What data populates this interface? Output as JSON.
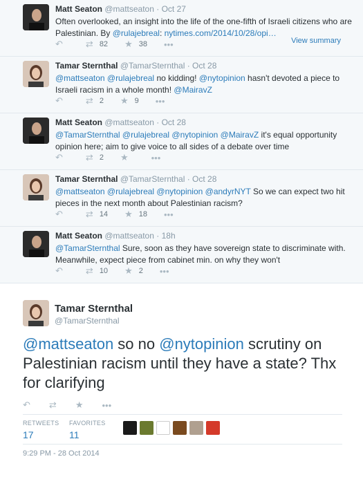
{
  "thread": [
    {
      "author": "Matt Seaton",
      "handle": "@mattseaton",
      "time": "Oct 27",
      "avatar": "m",
      "text_parts": [
        {
          "t": "Often overlooked, an insight into the life of the one-fifth of Israeli citizens who are Palestinian. By ",
          "link": false
        },
        {
          "t": "@rulajebreal",
          "link": true
        },
        {
          "t": ": ",
          "link": false
        },
        {
          "t": "nytimes.com/2014/10/28/opi…",
          "link": true
        }
      ],
      "retweets": "82",
      "favorites": "38",
      "view_summary": "View summary"
    },
    {
      "author": "Tamar Sternthal",
      "handle": "@TamarSternthal",
      "time": "Oct 28",
      "avatar": "t",
      "text_parts": [
        {
          "t": "@mattseaton @rulajebreal",
          "link": true
        },
        {
          "t": " no kidding! ",
          "link": false
        },
        {
          "t": "@nytopinion",
          "link": true
        },
        {
          "t": " hasn't devoted a piece to Israeli racism in a whole month! ",
          "link": false
        },
        {
          "t": "@MairavZ",
          "link": true
        }
      ],
      "retweets": "2",
      "favorites": "9"
    },
    {
      "author": "Matt Seaton",
      "handle": "@mattseaton",
      "time": "Oct 28",
      "avatar": "m",
      "text_parts": [
        {
          "t": "@TamarSternthal @rulajebreal @nytopinion @MairavZ",
          "link": true
        },
        {
          "t": " it's equal opportunity opinion here; aim to give voice to all sides of a debate over time",
          "link": false
        }
      ],
      "retweets": "2",
      "favorites": ""
    },
    {
      "author": "Tamar Sternthal",
      "handle": "@TamarSternthal",
      "time": "Oct 28",
      "avatar": "t",
      "text_parts": [
        {
          "t": "@mattseaton @rulajebreal @nytopinion @andyrNYT",
          "link": true
        },
        {
          "t": " So we can expect two hit pieces in the next month about Palestinian racism?",
          "link": false
        }
      ],
      "retweets": "14",
      "favorites": "18"
    },
    {
      "author": "Matt Seaton",
      "handle": "@mattseaton",
      "time": "18h",
      "avatar": "m",
      "text_parts": [
        {
          "t": "@TamarSternthal",
          "link": true
        },
        {
          "t": " Sure, soon as they have sovereign state to discriminate with. Meanwhile, expect piece from cabinet min. on why they won't",
          "link": false
        }
      ],
      "retweets": "10",
      "favorites": "2"
    }
  ],
  "main_tweet": {
    "author": "Tamar Sternthal",
    "handle": "@TamarSternthal",
    "text_parts": [
      {
        "t": "@mattseaton",
        "link": true
      },
      {
        "t": " so no ",
        "link": false
      },
      {
        "t": "@nytopinion",
        "link": true
      },
      {
        "t": " scrutiny on Palestinian racism until they have a state? Thx for clarifying",
        "link": false
      }
    ],
    "retweets_label": "RETWEETS",
    "retweets": "17",
    "favorites_label": "FAVORITES",
    "favorites": "11",
    "timestamp": "9:29 PM - 28 Oct 2014",
    "favoriter_colors": [
      "#1a1a1a",
      "#6b7a2f",
      "#ffffff",
      "#7a4a1f",
      "#b0a090",
      "#d43a2a"
    ]
  },
  "icons": {
    "reply": "reply-icon",
    "retweet": "retweet-icon",
    "favorite": "star-icon",
    "more": "more-icon"
  },
  "colors": {
    "link": "#2b7bb9",
    "muted": "#8899a6",
    "text": "#292f33",
    "thread_bg": "#f5f8fa"
  }
}
